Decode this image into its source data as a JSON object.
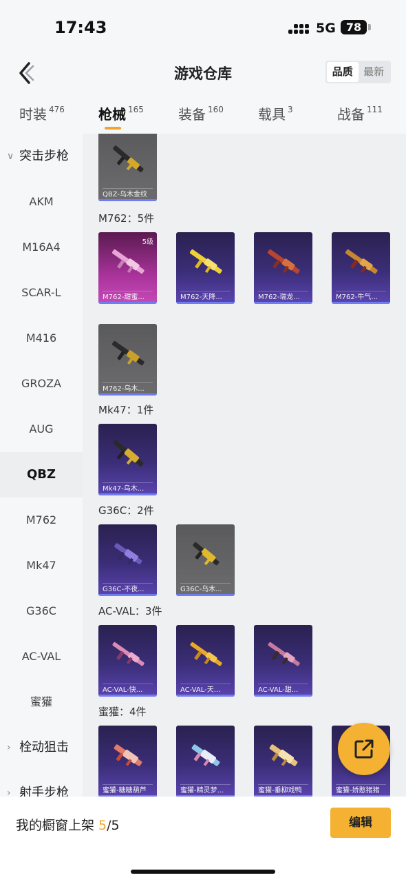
{
  "status_bar": {
    "time": "17:43",
    "network": "5G",
    "battery": "78"
  },
  "nav": {
    "title": "游戏仓库",
    "sort_options": [
      "品质",
      "最新"
    ]
  },
  "tabs": [
    {
      "label": "时装",
      "count": "476"
    },
    {
      "label": "枪械",
      "count": "165"
    },
    {
      "label": "装备",
      "count": "160"
    },
    {
      "label": "载具",
      "count": "3"
    },
    {
      "label": "战备",
      "count": "111"
    }
  ],
  "sidebar": {
    "group_open": "突击步枪",
    "items": [
      "AKM",
      "M16A4",
      "SCAR-L",
      "M416",
      "GROZA",
      "AUG",
      "QBZ",
      "M762",
      "Mk47",
      "G36C",
      "AC-VAL",
      "蜜獾"
    ],
    "groups_closed": [
      "栓动狙击",
      "射手步枪"
    ]
  },
  "content": {
    "qbz_cards": [
      {
        "name": "QBZ-乌木金纹"
      }
    ],
    "sections": [
      {
        "title": "M762：5件",
        "items": [
          "M762-甜蜜...",
          "M762-天降...",
          "M762-瑞龙...",
          "M762-牛气...",
          "M762-乌木..."
        ],
        "level": "5级"
      },
      {
        "title": "Mk47：1件",
        "items": [
          "Mk47-乌木..."
        ]
      },
      {
        "title": "G36C：2件",
        "items": [
          "G36C-不夜...",
          "G36C-乌木..."
        ]
      },
      {
        "title": "AC-VAL：3件",
        "items": [
          "AC-VAL-快...",
          "AC-VAL-天...",
          "AC-VAL-甜..."
        ]
      },
      {
        "title": "蜜獾：4件",
        "items": [
          "蜜獾-糖糖葫芦",
          "蜜獾-精灵梦...",
          "蜜獾-垂柳戏鸭",
          "蜜獾-娇憨猪猪"
        ]
      }
    ]
  },
  "bottom": {
    "shelf_label": "我的橱窗上架 ",
    "shelf_current": "5",
    "shelf_total": "/5",
    "edit_label": "编辑"
  },
  "colors": {
    "accent": "#f4a42a",
    "card_purple": "#3b2e78",
    "card_gray": "#6c6c6e",
    "card_pink": "#a8339a"
  }
}
